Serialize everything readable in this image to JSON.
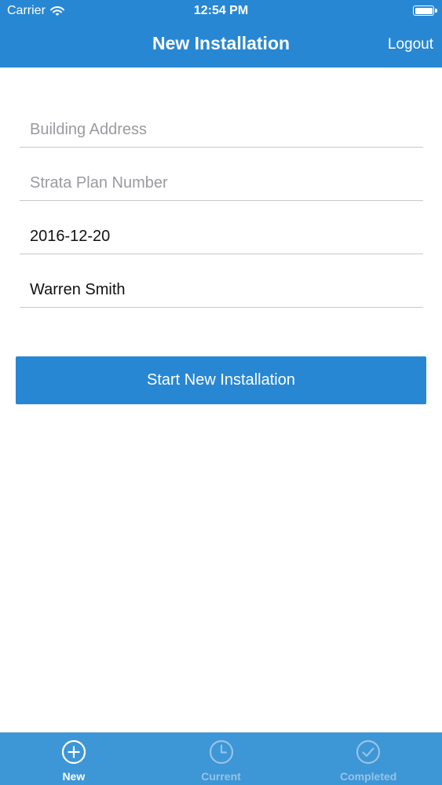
{
  "status_bar": {
    "carrier": "Carrier",
    "time": "12:54 PM",
    "battery_level": 1.0
  },
  "nav": {
    "title": "New Installation",
    "logout_label": "Logout"
  },
  "form": {
    "building_address": {
      "placeholder": "Building Address",
      "value": ""
    },
    "strata_plan_number": {
      "placeholder": "Strata Plan Number",
      "value": ""
    },
    "date": {
      "placeholder": "",
      "value": "2016-12-20"
    },
    "installer_name": {
      "placeholder": "",
      "value": "Warren Smith"
    }
  },
  "start_button_label": "Start New Installation",
  "tab_bar": {
    "tabs": [
      {
        "label": "New",
        "icon": "plus-circle-icon",
        "active": true
      },
      {
        "label": "Current",
        "icon": "clock-icon",
        "active": false
      },
      {
        "label": "Completed",
        "icon": "check-circle-icon",
        "active": false
      }
    ]
  },
  "colors": {
    "accent": "#2887d3",
    "tab_bar": "#3d96d5",
    "tab_inactive": "#97c3e6",
    "divider": "#c8c7cc"
  }
}
